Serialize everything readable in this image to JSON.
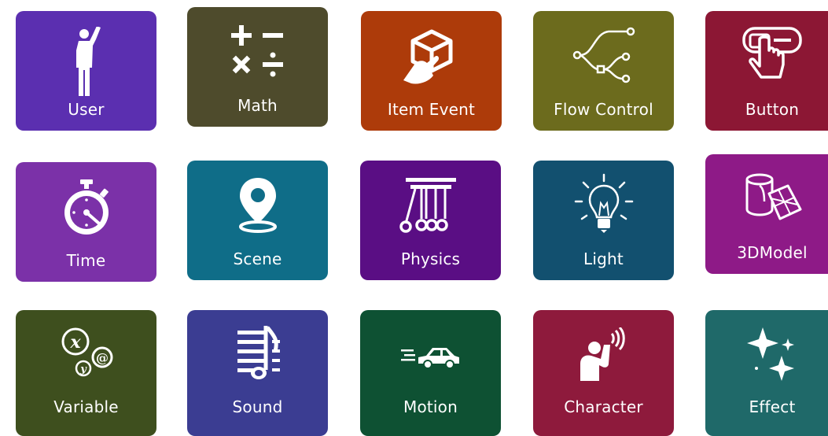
{
  "tiles": [
    {
      "label": "User",
      "color": "#5b2fb0",
      "icon": "user-waving-icon"
    },
    {
      "label": "Math",
      "color": "#4e4b2c",
      "icon": "math-operators-icon"
    },
    {
      "label": "Item Event",
      "color": "#ad3b0a",
      "icon": "cube-tap-icon"
    },
    {
      "label": "Flow Control",
      "color": "#6c6b1d",
      "icon": "flow-branch-icon"
    },
    {
      "label": "Button",
      "color": "#8c1734",
      "icon": "button-press-icon"
    },
    {
      "label": "Time",
      "color": "#7b31a8",
      "icon": "stopwatch-icon"
    },
    {
      "label": "Scene",
      "color": "#0f6d88",
      "icon": "location-pin-icon"
    },
    {
      "label": "Physics",
      "color": "#5a0e84",
      "icon": "newtons-cradle-icon"
    },
    {
      "label": "Light",
      "color": "#12506f",
      "icon": "lightbulb-icon"
    },
    {
      "label": "3DModel",
      "color": "#8e1a87",
      "icon": "3d-shapes-icon"
    },
    {
      "label": "Variable",
      "color": "#3e4f1e",
      "icon": "variable-symbols-icon"
    },
    {
      "label": "Sound",
      "color": "#3b3d92",
      "icon": "music-note-icon"
    },
    {
      "label": "Motion",
      "color": "#0e5133",
      "icon": "moving-car-icon"
    },
    {
      "label": "Character",
      "color": "#8e1a3c",
      "icon": "character-speaking-icon"
    },
    {
      "label": "Effect",
      "color": "#1f6969",
      "icon": "sparkles-icon"
    }
  ]
}
